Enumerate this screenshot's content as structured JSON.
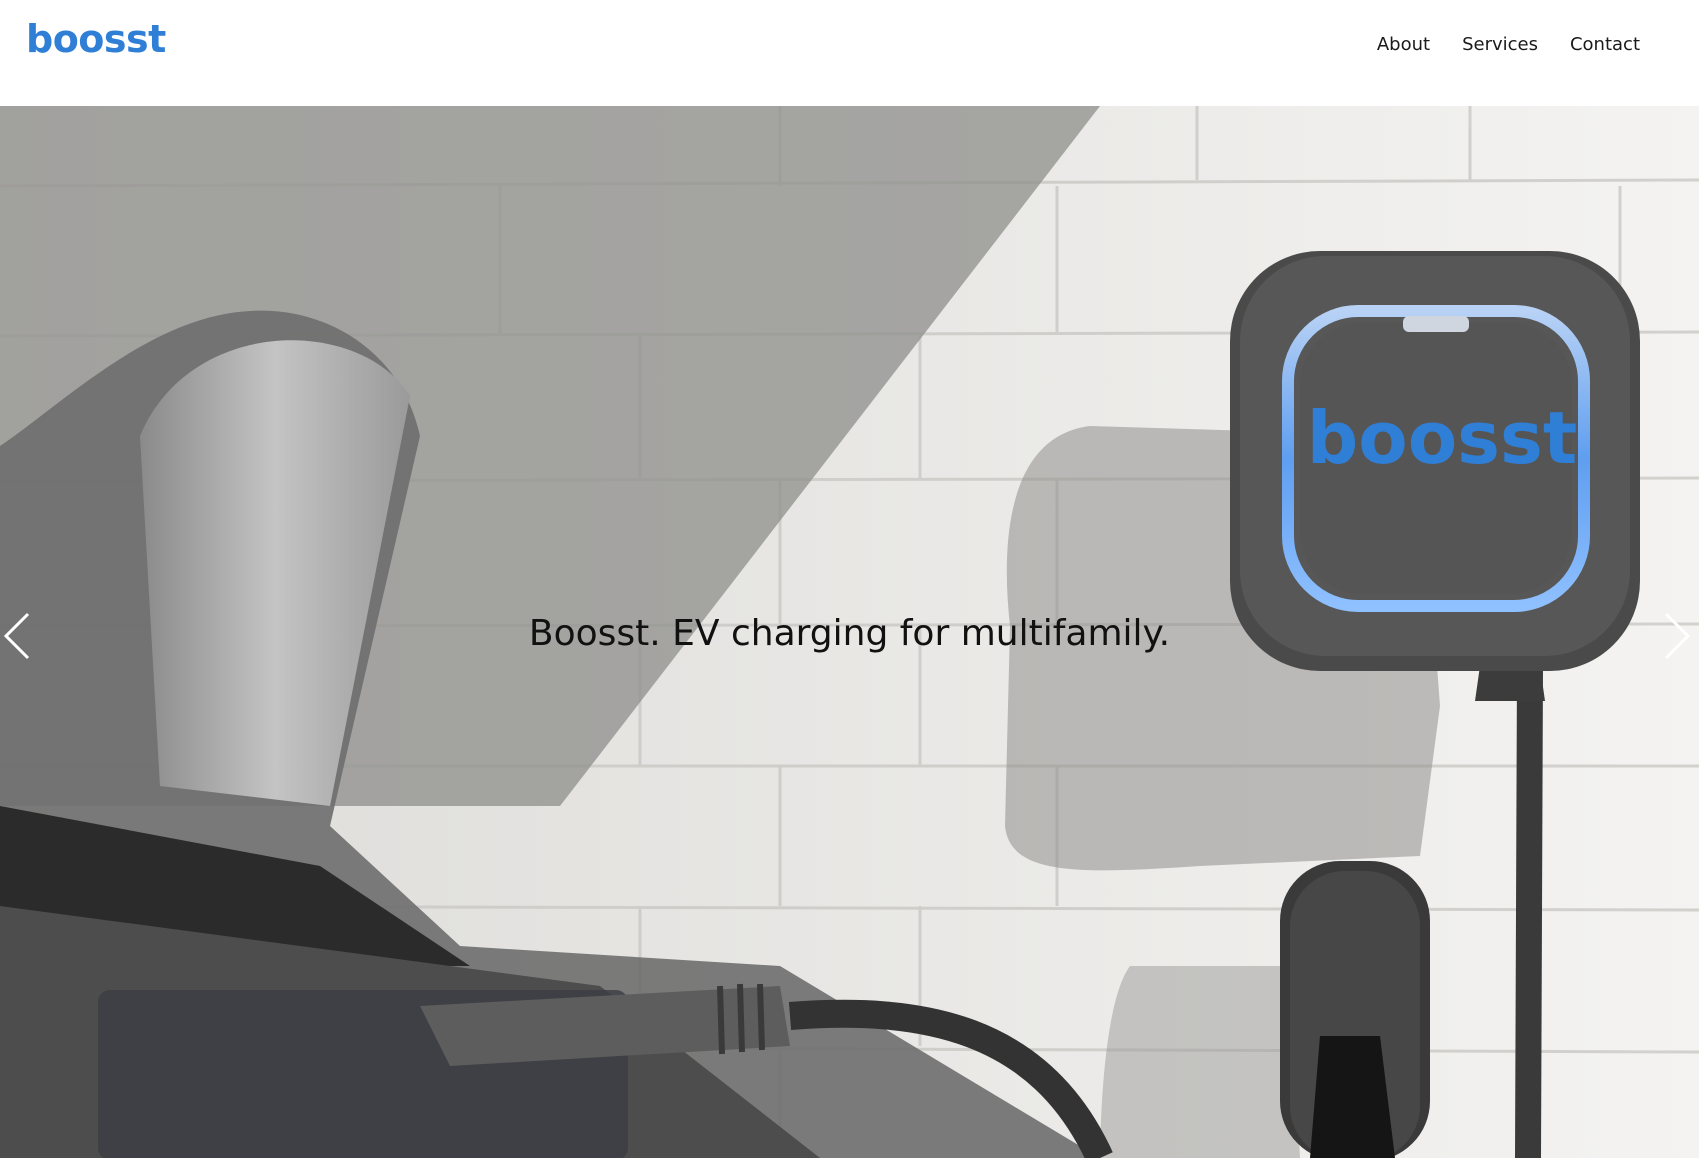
{
  "header": {
    "logo_text": "boosst",
    "nav": [
      {
        "label": "About"
      },
      {
        "label": "Services"
      },
      {
        "label": "Contact"
      }
    ]
  },
  "hero": {
    "headline": "Boosst. EV charging for multifamily.",
    "charger_logo_text": "boosst",
    "prev_icon": "chevron-left-icon",
    "next_icon": "chevron-right-icon"
  },
  "colors": {
    "brand_blue": "#2f7fd6",
    "text_dark": "#111111",
    "header_bg": "#ffffff"
  }
}
